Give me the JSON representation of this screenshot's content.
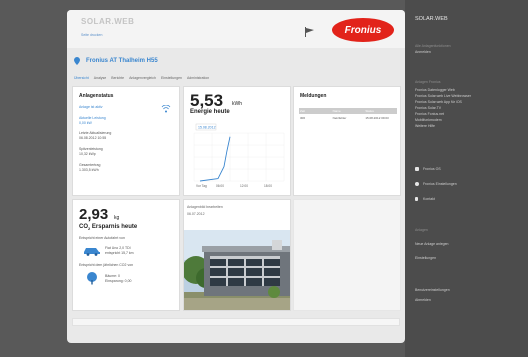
{
  "header": {
    "brand_title": "SOLAR.WEB",
    "brand_link": "Seite drucken",
    "logo_text": "Fronius"
  },
  "plant": {
    "name": "Fronius AT Thalheim H55"
  },
  "tabs": [
    "Übersicht",
    "Analyse",
    "Berichte",
    "Anlagenvergleich",
    "Einstellungen",
    "Administration"
  ],
  "anlagenstatus": {
    "title": "Anlagenstatus",
    "status_link": "Anlage ist aktiv",
    "last_link": "Aktuelle Leistung",
    "last_value": "0,00 kW",
    "last_update_label": "Letzte Aktualisierung",
    "last_update_value": "06.08.2012 10:55",
    "peak_label": "Spitzenleistung",
    "peak_value": "10,32 kWp",
    "total_label": "Gesamtertrag",
    "total_value": "1.303,5 kWh"
  },
  "energie": {
    "value": "5,53",
    "unit": "kWh",
    "label": "Energie heute",
    "chart_tooltip": "15.08.2012",
    "x_labels": [
      "Vor Tag",
      "06:00",
      "12:00",
      "18:00"
    ]
  },
  "chart_data": {
    "type": "line",
    "x": [
      "06:00",
      "09:00",
      "10:00",
      "10:30",
      "11:00"
    ],
    "values": [
      0,
      0.3,
      1.8,
      3.8,
      5.53
    ],
    "xlabel": "",
    "ylabel": "",
    "grid": true
  },
  "meldungen": {
    "title": "Meldungen",
    "headers": [
      "Zeit",
      "Name",
      "Status"
    ],
    "rows": [
      [
        "306",
        "Netzfehler",
        "15.08.2012 09:03"
      ]
    ]
  },
  "co2": {
    "value": "2,93",
    "unit": "kg",
    "label_prefix": "CO",
    "label_sub": "2",
    "label_suffix": " Ersparnis heute",
    "intro": "Entspricht einer Autofahrt von",
    "car_line1": "Fiat Uno 2,0 TDI",
    "car_line2": "entspricht 15,7 km",
    "tree_intro": "Entspricht dem jährlichen CO2 von",
    "tree_line1": "Bäume: 0",
    "tree_line2": "Einsparung: 0,00"
  },
  "photo": {
    "label": "Anlagenbild bearbeiten",
    "date": "06.07.2012"
  },
  "sidebar": {
    "title": "SOLAR.WEB",
    "section1_head": "Alle Anlagenfunktionen",
    "section1_link": "Anmelden",
    "section2_head": "Anlagen Fronius",
    "links": [
      "Fronius Datenlogger Web",
      "Fronius Solar.web Live Webbrowser",
      "Fronius Solar.web App für iOS",
      "Fronius Solar.TV",
      "Fronius Fonius.net",
      "Mobilfunkmodem",
      "Weitere Hilfe"
    ],
    "actions": [
      "Fronius OS",
      "Fronius Einstellungen",
      "Kontakt"
    ],
    "section3_head": "Anlagen",
    "section3_links": [
      "Neue Anlage anlegen",
      "Einstellungen"
    ],
    "footer_links": [
      "Benutzereinstellungen",
      "Abmelden"
    ]
  }
}
